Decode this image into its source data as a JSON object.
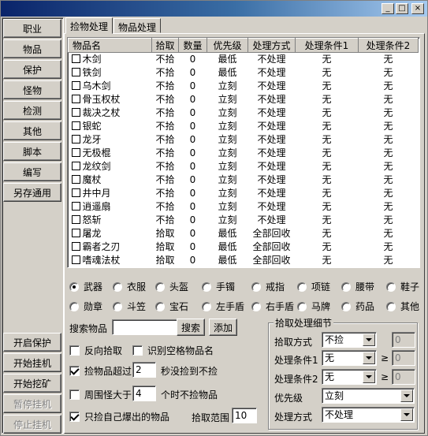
{
  "window": {
    "min_icon": "_",
    "max_icon": "□",
    "close_icon": "×"
  },
  "sidebar": {
    "top": [
      "职业",
      "物品",
      "保护",
      "怪物",
      "检测",
      "其他",
      "脚本",
      "编写",
      "另存通用"
    ],
    "bottom": [
      {
        "label": "开启保护",
        "enabled": true
      },
      {
        "label": "开始挂机",
        "enabled": true
      },
      {
        "label": "开始挖矿",
        "enabled": true
      },
      {
        "label": "暂停挂机",
        "enabled": false
      },
      {
        "label": "停止挂机",
        "enabled": false
      }
    ]
  },
  "tabs": [
    "捡物处理",
    "物品处理"
  ],
  "table": {
    "columns": [
      "物品名",
      "拾取",
      "数量",
      "优先级",
      "处理方式",
      "处理条件1",
      "处理条件2"
    ],
    "rows": [
      [
        "木剑",
        "不拾",
        "0",
        "最低",
        "不处理",
        "无",
        "无"
      ],
      [
        "铁剑",
        "不拾",
        "0",
        "最低",
        "不处理",
        "无",
        "无"
      ],
      [
        "乌木剑",
        "不拾",
        "0",
        "立刻",
        "不处理",
        "无",
        "无"
      ],
      [
        "骨玉权杖",
        "不拾",
        "0",
        "立刻",
        "不处理",
        "无",
        "无"
      ],
      [
        "裁决之杖",
        "不拾",
        "0",
        "立刻",
        "不处理",
        "无",
        "无"
      ],
      [
        "银蛇",
        "不拾",
        "0",
        "立刻",
        "不处理",
        "无",
        "无"
      ],
      [
        "龙牙",
        "不拾",
        "0",
        "立刻",
        "不处理",
        "无",
        "无"
      ],
      [
        "无极棍",
        "不拾",
        "0",
        "立刻",
        "不处理",
        "无",
        "无"
      ],
      [
        "龙纹剑",
        "不拾",
        "0",
        "立刻",
        "不处理",
        "无",
        "无"
      ],
      [
        "魔杖",
        "不拾",
        "0",
        "立刻",
        "不处理",
        "无",
        "无"
      ],
      [
        "井中月",
        "不拾",
        "0",
        "立刻",
        "不处理",
        "无",
        "无"
      ],
      [
        "逍遥扇",
        "不拾",
        "0",
        "立刻",
        "不处理",
        "无",
        "无"
      ],
      [
        "怒斩",
        "不拾",
        "0",
        "立刻",
        "不处理",
        "无",
        "无"
      ],
      [
        "屠龙",
        "拾取",
        "0",
        "最低",
        "全部回收",
        "无",
        "无"
      ],
      [
        "霸者之刃",
        "拾取",
        "0",
        "最低",
        "全部回收",
        "无",
        "无"
      ],
      [
        "嗜魂法杖",
        "拾取",
        "0",
        "最低",
        "全部回收",
        "无",
        "无"
      ]
    ]
  },
  "categories": {
    "row1": [
      "武器",
      "衣服",
      "头盔",
      "手镯",
      "戒指",
      "项链",
      "腰带",
      "鞋子"
    ],
    "row2": [
      "勋章",
      "斗笠",
      "宝石",
      "左手盾",
      "右手盾",
      "马牌",
      "药品",
      "其他"
    ],
    "selected": "武器"
  },
  "search": {
    "label": "搜索物品",
    "value": "",
    "search_btn": "搜索",
    "add_btn": "添加"
  },
  "options": {
    "reverse_pick": {
      "label": "反向拾取",
      "checked": false
    },
    "identify_name": {
      "label": "识别空格物品名",
      "checked": false
    },
    "pick_timeout": {
      "label": "捡物品超过",
      "value": "2",
      "suffix": "秒没捡到不捡",
      "checked": true
    },
    "monster_count": {
      "label": "周围怪大于",
      "value": "4",
      "suffix": "个时不捡物品",
      "checked": false
    },
    "own_drops": {
      "label": "只捡自己爆出的物品",
      "checked": true
    },
    "pick_range": {
      "label": "拾取范围",
      "value": "10"
    }
  },
  "detail": {
    "title": "拾取处理细节",
    "pick_mode": {
      "label": "拾取方式",
      "value": "不捡",
      "num": "0"
    },
    "cond1": {
      "label": "处理条件1",
      "value": "无",
      "ge": "≥",
      "num": "0"
    },
    "cond2": {
      "label": "处理条件2",
      "value": "无",
      "ge": "≥",
      "num": "0"
    },
    "priority": {
      "label": "优先级",
      "value": "立刻"
    },
    "method": {
      "label": "处理方式",
      "value": "不处理"
    }
  }
}
